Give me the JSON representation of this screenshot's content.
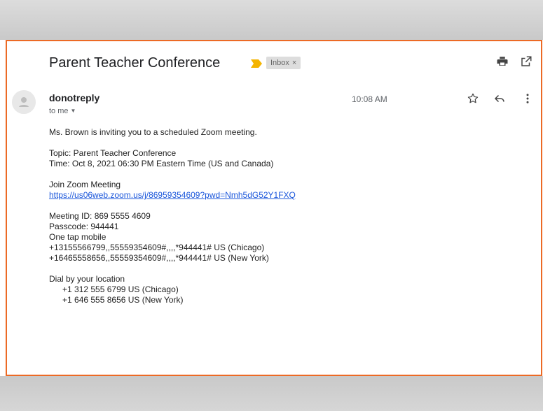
{
  "email": {
    "subject": "Parent Teacher Conference",
    "label": {
      "text": "Inbox",
      "close": "×"
    },
    "sender": "donotreply",
    "recipient": "to me",
    "time": "10:08 AM",
    "body": {
      "intro": "Ms. Brown is inviting you to a scheduled Zoom meeting.",
      "topic": "Topic: Parent Teacher Conference",
      "when": "Time: Oct 8, 2021 06:30 PM Eastern Time (US and Canada)",
      "join_heading": "Join Zoom Meeting",
      "join_link": "https://us06web.zoom.us/j/86959354609?pwd=Nmh5dG52Y1FXQ",
      "meeting_id": "Meeting ID: 869 5555 4609",
      "passcode": "Passcode: 944441",
      "one_tap_heading": "One tap mobile",
      "one_tap": [
        "+13155566799,,55559354609#,,,,*944441# US (Chicago)",
        "+16465558656,,55559354609#,,,,*944441# US (New York)"
      ],
      "dial_heading": "Dial by your location",
      "dial": [
        "+1 312 555 6799 US (Chicago)",
        "+1 646 555 8656 US (New York)"
      ]
    }
  },
  "icons": {
    "label_marker": "label-important-icon",
    "print": "print-icon",
    "new_window": "open-in-new-window-icon",
    "star": "star-icon",
    "reply": "reply-icon",
    "more": "more-vertical-icon",
    "avatar": "avatar-icon"
  },
  "colors": {
    "frame_border": "#ec6a25",
    "label_marker": "#f4b400",
    "link": "#1a56db"
  }
}
